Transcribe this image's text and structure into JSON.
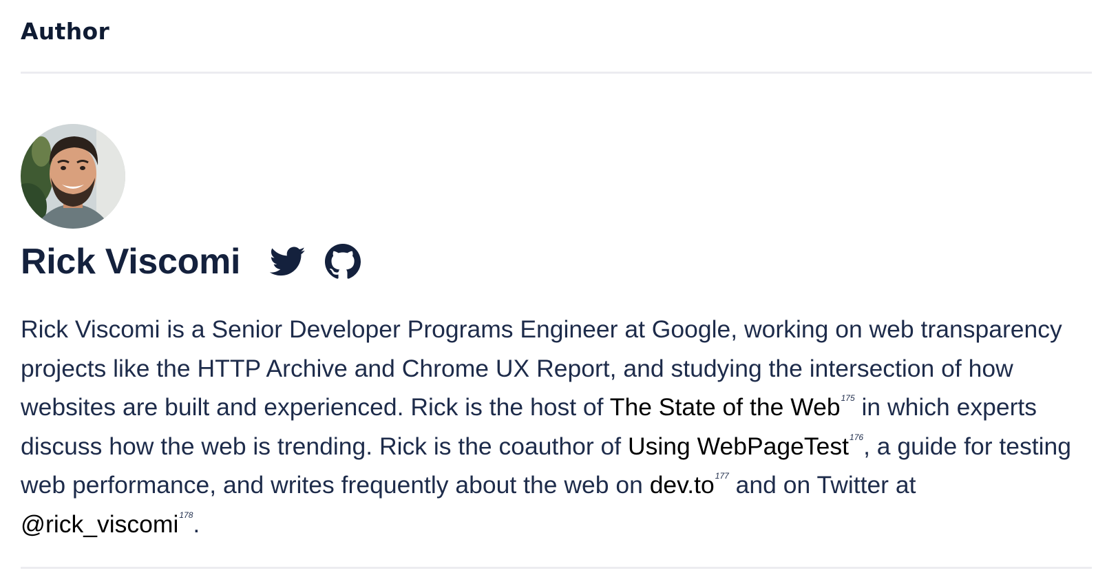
{
  "section": {
    "heading": "Author"
  },
  "author": {
    "name": "Rick Viscomi",
    "social": [
      {
        "icon": "twitter-icon",
        "label": "Twitter"
      },
      {
        "icon": "github-icon",
        "label": "GitHub"
      }
    ]
  },
  "bio": {
    "t1": "Rick Viscomi is a Senior Developer Programs Engineer at Google, working on web transparency projects like the HTTP Archive and Chrome UX Report, and studying the intersection of how websites are built and experienced. Rick is the host of ",
    "link1": "The State of the Web",
    "fn1": "175",
    "t2": " in which experts discuss how the web is trending. Rick is the coauthor of ",
    "link2": "Using WebPageTest",
    "fn2": "176",
    "t3": ", a guide for testing web performance, and writes frequently about the web on ",
    "link3": "dev.to",
    "fn3": "177",
    "t4": " and on Twitter at ",
    "link4": "@rick_viscomi",
    "fn4": "178",
    "t5": "."
  },
  "colors": {
    "text": "#1d2b4a",
    "heading": "#0f1b33",
    "link": "#000000",
    "rule": "#ececf0"
  }
}
